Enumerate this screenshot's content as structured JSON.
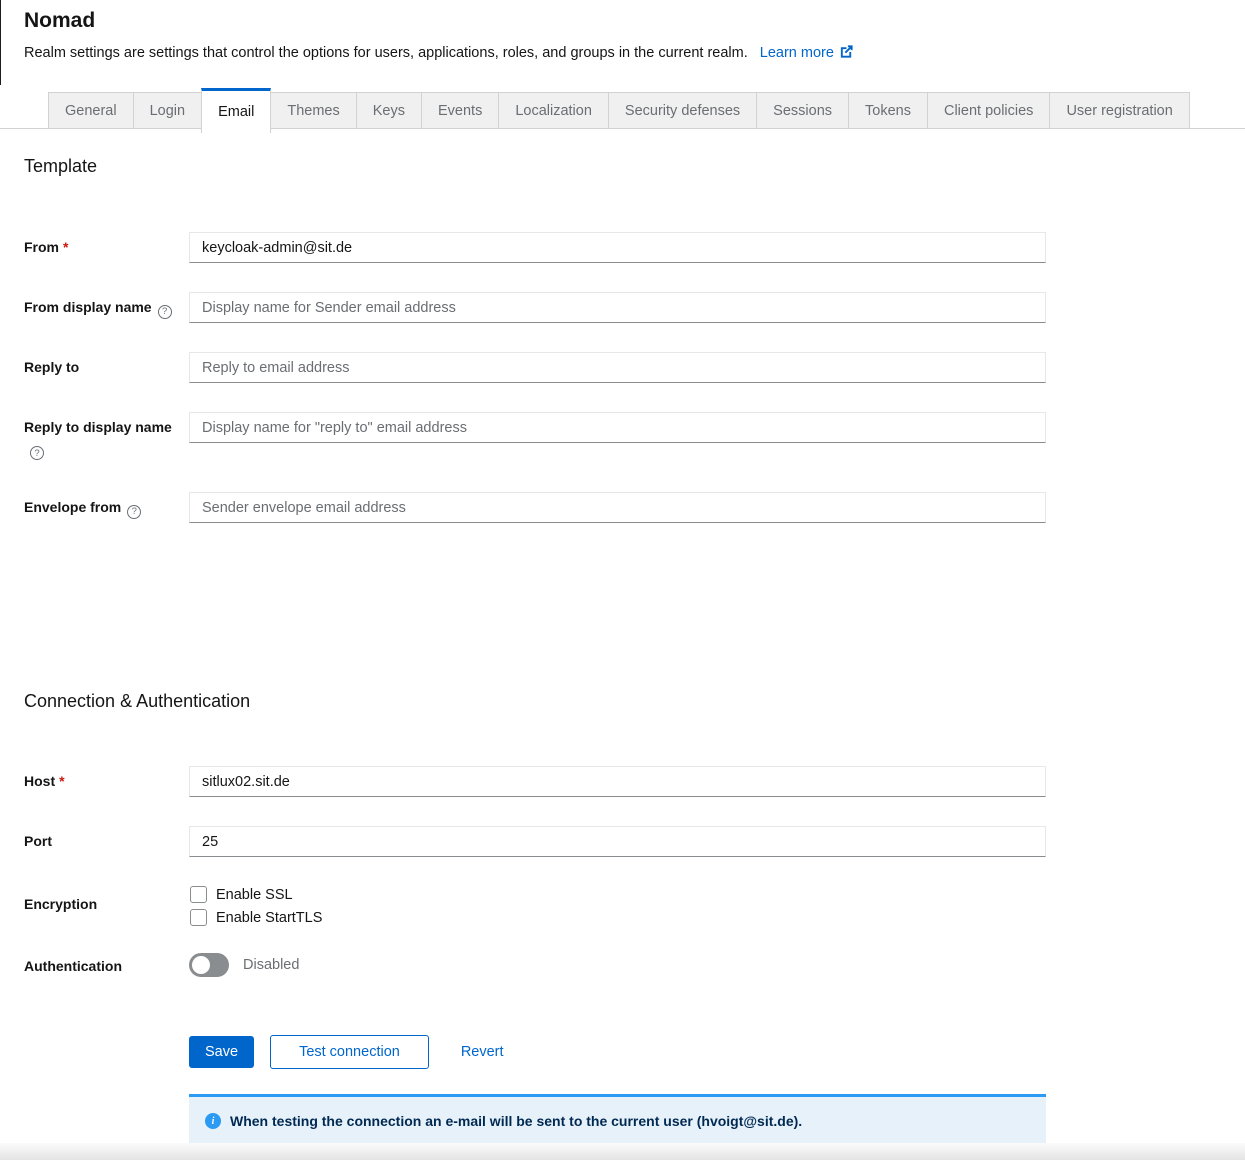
{
  "header": {
    "title": "Nomad",
    "description": "Realm settings are settings that control the options for users, applications, roles, and groups in the current realm.",
    "learn_more_label": "Learn more"
  },
  "tabs": {
    "active": "Email",
    "items": [
      {
        "label": "General"
      },
      {
        "label": "Login"
      },
      {
        "label": "Email"
      },
      {
        "label": "Themes"
      },
      {
        "label": "Keys"
      },
      {
        "label": "Events"
      },
      {
        "label": "Localization"
      },
      {
        "label": "Security defenses"
      },
      {
        "label": "Sessions"
      },
      {
        "label": "Tokens"
      },
      {
        "label": "Client policies"
      },
      {
        "label": "User registration"
      }
    ]
  },
  "sections": {
    "template": {
      "title": "Template"
    },
    "connection": {
      "title": "Connection & Authentication"
    }
  },
  "form": {
    "from": {
      "label": "From",
      "required": "*",
      "value": "keycloak-admin@sit.de"
    },
    "from_display_name": {
      "label": "From display name",
      "placeholder": "Display name for Sender email address"
    },
    "reply_to": {
      "label": "Reply to",
      "placeholder": "Reply to email address"
    },
    "reply_to_display_name": {
      "label": "Reply to display name",
      "placeholder": "Display name for \"reply to\" email address"
    },
    "envelope_from": {
      "label": "Envelope from",
      "placeholder": "Sender envelope email address"
    },
    "host": {
      "label": "Host",
      "required": "*",
      "value": "sitlux02.sit.de"
    },
    "port": {
      "label": "Port",
      "value": "25"
    },
    "encryption": {
      "label": "Encryption",
      "options": [
        "Enable SSL",
        "Enable StartTLS"
      ]
    },
    "authentication": {
      "label": "Authentication",
      "state": "Disabled"
    }
  },
  "actions": {
    "save": "Save",
    "test_connection": "Test connection",
    "revert": "Revert"
  },
  "alert": {
    "text": "When testing the connection an e-mail will be sent to the current user (hvoigt@sit.de)."
  },
  "icons": {
    "help_glyph": "?",
    "info_glyph": "i"
  },
  "colors": {
    "primary": "#0066cc",
    "active_tab_accent": "#0066cc",
    "alert_accent": "#2b9af3",
    "alert_background": "#e7f1fa",
    "alert_text": "#002952",
    "required_asterisk": "#c9190b",
    "inactive_tab_background": "#f0f0f0",
    "switch_off": "#8a8d90"
  }
}
